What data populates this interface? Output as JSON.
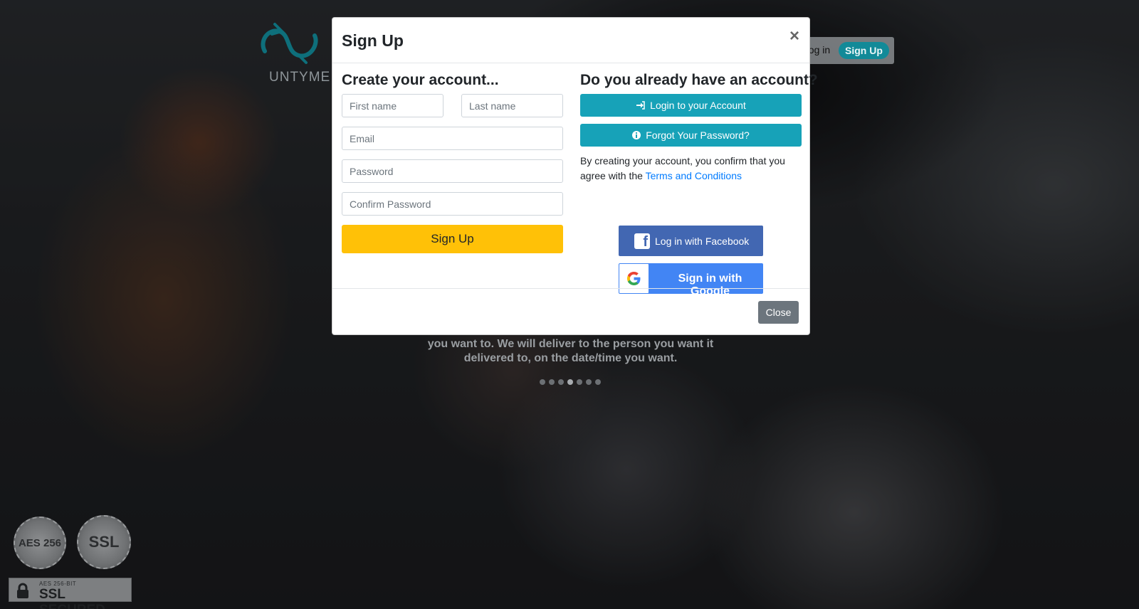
{
  "background": {
    "logo_text": "UNTYME",
    "nav": {
      "login_label": "Log in",
      "signup_label": "Sign Up"
    },
    "hero_text": "you want to. We will deliver to the person you want it delivered to, on the date/time you want.",
    "carousel": {
      "total_dots": 7,
      "active_index": 3
    },
    "badges": {
      "aes_seal": "AES 256",
      "ssl_seal": "SSL",
      "ssl_small": "AES 256-BIT",
      "ssl_big": "SSL SECURED"
    }
  },
  "modal": {
    "title": "Sign Up",
    "close_symbol": "×",
    "left": {
      "heading": "Create your account...",
      "first_name_placeholder": "First name",
      "last_name_placeholder": "Last name",
      "email_placeholder": "Email",
      "password_placeholder": "Password",
      "confirm_password_placeholder": "Confirm Password",
      "signup_button": "Sign Up"
    },
    "right": {
      "heading": "Do you already have an account?",
      "login_button": "Login to your Account",
      "forgot_button": "Forgot Your Password?",
      "terms_text": "By creating your account, you confirm that you agree with the ",
      "terms_link": "Terms and Conditions",
      "facebook_button": "Log in with Facebook",
      "google_button": "Sign in with Google"
    },
    "footer": {
      "close_button": "Close"
    }
  },
  "colors": {
    "brand_teal": "#128a98",
    "info": "#17a2b8",
    "warning": "#ffc107",
    "facebook": "#4267b2",
    "google": "#4285f4",
    "secondary": "#6c757d",
    "link": "#007bff"
  }
}
